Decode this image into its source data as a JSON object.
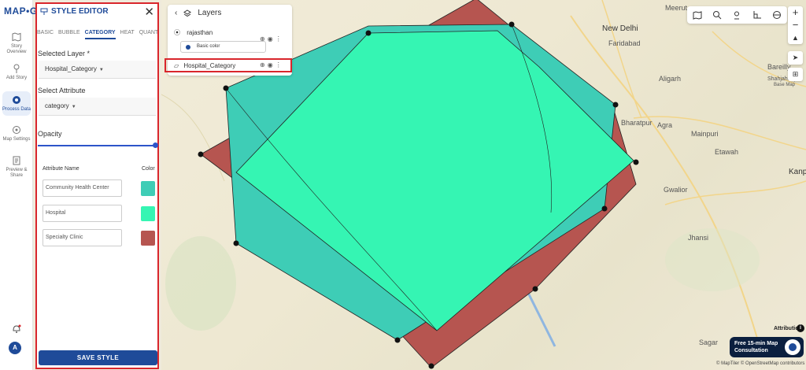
{
  "brand": {
    "logo": "MAP•G"
  },
  "rail": {
    "items": [
      {
        "label": "Story Overview",
        "icon": "map-icon"
      },
      {
        "label": "Add Story",
        "icon": "pin-icon"
      },
      {
        "label": "Process Data",
        "icon": "gear-icon"
      },
      {
        "label": "Map Settings",
        "icon": "settings-icon"
      },
      {
        "label": "Preview & Share",
        "icon": "share-icon"
      }
    ],
    "avatar": "A"
  },
  "editor": {
    "title": "STYLE EDITOR",
    "tabs": [
      "BASIC",
      "BUBBLE",
      "CATEGORY",
      "HEAT",
      "QUANTITY"
    ],
    "active_tab": "CATEGORY",
    "selected_layer_label": "Selected Layer *",
    "selected_layer_value": "Hospital_Category",
    "select_attribute_label": "Select Attribute",
    "select_attribute_value": "category",
    "opacity_label": "Opacity",
    "opacity_value": 1.0,
    "attr_name_header": "Attribute Name",
    "color_header": "Color",
    "attributes": [
      {
        "name": "Community Health Center",
        "color": "#3ecdb6"
      },
      {
        "name": "Hospital",
        "color": "#35f5b3"
      },
      {
        "name": "Specialty Clinic",
        "color": "#b65550"
      }
    ],
    "save_label": "SAVE STYLE"
  },
  "layers": {
    "title": "Layers",
    "items": [
      {
        "name": "rajasthan",
        "sub": "Basic color"
      },
      {
        "name": "Hospital_Category"
      }
    ]
  },
  "map": {
    "cities": [
      "New Delhi",
      "Faridabad",
      "Meerut",
      "Bareilly",
      "Shahjahanpur",
      "Aligarh",
      "Base Map",
      "Bharatpur",
      "Agra",
      "Mainpuri",
      "Etawah",
      "Kanpur",
      "Gwalior",
      "Jhansi",
      "Sagar"
    ],
    "attribution": "Attribution",
    "credit": "© MapTiler © OpenStreetMap contributors",
    "consult": "Free 15-min Map Consultation"
  }
}
